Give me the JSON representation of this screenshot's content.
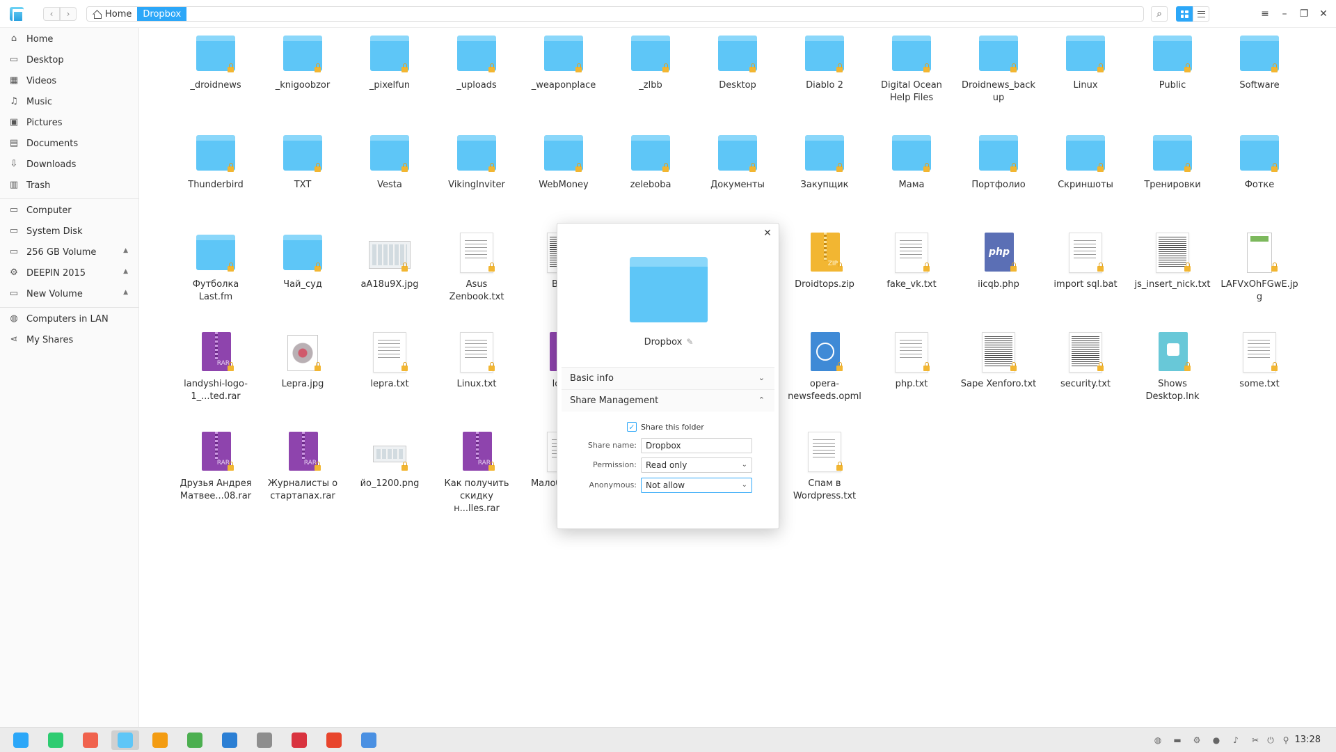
{
  "titlebar": {
    "breadcrumbs": [
      "Home",
      "Dropbox"
    ],
    "back_glyph": "‹",
    "forward_glyph": "›",
    "search_glyph": "⌕",
    "menu_glyph": "≡",
    "minimize_glyph": "–",
    "maximize_glyph": "❐",
    "close_glyph": "✕"
  },
  "sidebar": {
    "items": [
      {
        "label": "Home",
        "icon": "⌂"
      },
      {
        "label": "Desktop",
        "icon": "▭"
      },
      {
        "label": "Videos",
        "icon": "▦"
      },
      {
        "label": "Music",
        "icon": "♫"
      },
      {
        "label": "Pictures",
        "icon": "▣"
      },
      {
        "label": "Documents",
        "icon": "▤"
      },
      {
        "label": "Downloads",
        "icon": "⇩"
      },
      {
        "label": "Trash",
        "icon": "▥"
      }
    ],
    "devices": [
      {
        "label": "Computer",
        "icon": "▭",
        "eject": ""
      },
      {
        "label": "System Disk",
        "icon": "▭",
        "eject": ""
      },
      {
        "label": "256 GB Volume",
        "icon": "▭",
        "eject": "▲"
      },
      {
        "label": "DEEPIN 2015",
        "icon": "⚙",
        "eject": "▲"
      },
      {
        "label": "New Volume",
        "icon": "▭",
        "eject": "▲"
      }
    ],
    "network": [
      {
        "label": "Computers in LAN",
        "icon": "◍"
      },
      {
        "label": "My Shares",
        "icon": "⋖"
      }
    ]
  },
  "files": [
    {
      "name": "_droidnews",
      "kind": "folder"
    },
    {
      "name": "_knigoobzor",
      "kind": "folder"
    },
    {
      "name": "_pixelfun",
      "kind": "folder"
    },
    {
      "name": "_uploads",
      "kind": "folder"
    },
    {
      "name": "_weaponplace",
      "kind": "folder"
    },
    {
      "name": "_zlbb",
      "kind": "folder"
    },
    {
      "name": "Desktop",
      "kind": "folder"
    },
    {
      "name": "Diablo 2",
      "kind": "folder"
    },
    {
      "name": "Digital Ocean Help Files",
      "kind": "folder"
    },
    {
      "name": "Droidnews_back up",
      "kind": "folder"
    },
    {
      "name": "Linux",
      "kind": "folder"
    },
    {
      "name": "Public",
      "kind": "folder"
    },
    {
      "name": "Software",
      "kind": "folder"
    },
    {
      "name": "Thunderbird",
      "kind": "folder"
    },
    {
      "name": "TXT",
      "kind": "folder"
    },
    {
      "name": "Vesta",
      "kind": "folder"
    },
    {
      "name": "VikingInviter",
      "kind": "folder"
    },
    {
      "name": "WebMoney",
      "kind": "folder"
    },
    {
      "name": "zeleboba",
      "kind": "folder"
    },
    {
      "name": "Документы",
      "kind": "folder"
    },
    {
      "name": "Закупщик",
      "kind": "folder"
    },
    {
      "name": "Мама",
      "kind": "folder"
    },
    {
      "name": "Портфолио",
      "kind": "folder"
    },
    {
      "name": "Скриншоты",
      "kind": "folder"
    },
    {
      "name": "Тренировки",
      "kind": "folder"
    },
    {
      "name": "Фотке",
      "kind": "folder"
    },
    {
      "name": "Футболка Last.fm",
      "kind": "folder"
    },
    {
      "name": "Чай_суд",
      "kind": "folder"
    },
    {
      "name": "aA18u9X.jpg",
      "kind": "img"
    },
    {
      "name": "Asus Zenbook.txt",
      "kind": "doc"
    },
    {
      "name": "Bike_",
      "kind": "doc-dense"
    },
    {
      "name": "",
      "kind": "hidden"
    },
    {
      "name": "",
      "kind": "hidden"
    },
    {
      "name": "Droidtops.zip",
      "kind": "zip"
    },
    {
      "name": "fake_vk.txt",
      "kind": "doc"
    },
    {
      "name": "iicqb.php",
      "kind": "php"
    },
    {
      "name": "import sql.bat",
      "kind": "doc"
    },
    {
      "name": "js_insert_nick.txt",
      "kind": "doc-dense"
    },
    {
      "name": "LAFVxOhFGwE.jpg",
      "kind": "img-tall"
    },
    {
      "name": "landyshi-logo-1_...ted.rar",
      "kind": "rar"
    },
    {
      "name": "Lepra.jpg",
      "kind": "img-photo"
    },
    {
      "name": "lepra.txt",
      "kind": "doc"
    },
    {
      "name": "Linux.txt",
      "kind": "doc"
    },
    {
      "name": "logo-",
      "kind": "rar"
    },
    {
      "name": "",
      "kind": "hidden"
    },
    {
      "name": "",
      "kind": "hidden"
    },
    {
      "name": "opera-newsfeeds.opml",
      "kind": "opml"
    },
    {
      "name": "php.txt",
      "kind": "doc"
    },
    {
      "name": "Sape Xenforo.txt",
      "kind": "doc-dense"
    },
    {
      "name": "security.txt",
      "kind": "doc-dense"
    },
    {
      "name": "Shows Desktop.lnk",
      "kind": "lnk"
    },
    {
      "name": "some.txt",
      "kind": "doc"
    },
    {
      "name": "Друзья Андрея Матвее...08.rar",
      "kind": "rar"
    },
    {
      "name": "Журналисты о стартапах.rar",
      "kind": "rar"
    },
    {
      "name": "йо_1200.png",
      "kind": "img-mid"
    },
    {
      "name": "Как получить скидку н...lles.rar",
      "kind": "rar"
    },
    {
      "name": "Малоб й марк",
      "kind": "doc"
    },
    {
      "name": "",
      "kind": "hidden"
    },
    {
      "name": "",
      "kind": "hidden"
    },
    {
      "name": "Спам в Wordpress.txt",
      "kind": "doc"
    }
  ],
  "dialog": {
    "close_glyph": "✕",
    "folder_name": "Dropbox",
    "edit_glyph": "✎",
    "sections": {
      "basic_info": "Basic info",
      "share_management": "Share Management",
      "collapsed_glyph": "⌄",
      "expanded_glyph": "⌃"
    },
    "share_checkbox": {
      "label": "Share this folder",
      "checked": true,
      "glyph": "✓"
    },
    "share_name": {
      "label": "Share name:",
      "value": "Dropbox"
    },
    "permission": {
      "label": "Permission:",
      "value": "Read only"
    },
    "anonymous": {
      "label": "Anonymous:",
      "value": "Not allow"
    },
    "select_glyph": "⌄"
  },
  "dock": {
    "apps": [
      {
        "name": "launcher",
        "color": "#2ca7f8"
      },
      {
        "name": "desktop",
        "color": "#2ecc71"
      },
      {
        "name": "screen-recorder",
        "color": "#f0624d"
      },
      {
        "name": "file-manager",
        "color": "#5ec6f7"
      },
      {
        "name": "archive-manager",
        "color": "#f39c12"
      },
      {
        "name": "media-player",
        "color": "#4caf50"
      },
      {
        "name": "video-player",
        "color": "#2b7fd4"
      },
      {
        "name": "settings",
        "color": "#8e8e8e"
      },
      {
        "name": "terminal",
        "color": "#d9333f"
      },
      {
        "name": "yandex-browser",
        "color": "#e8452c"
      },
      {
        "name": "qbittorrent",
        "color": "#4a90e2"
      }
    ],
    "clock": "13:28"
  }
}
